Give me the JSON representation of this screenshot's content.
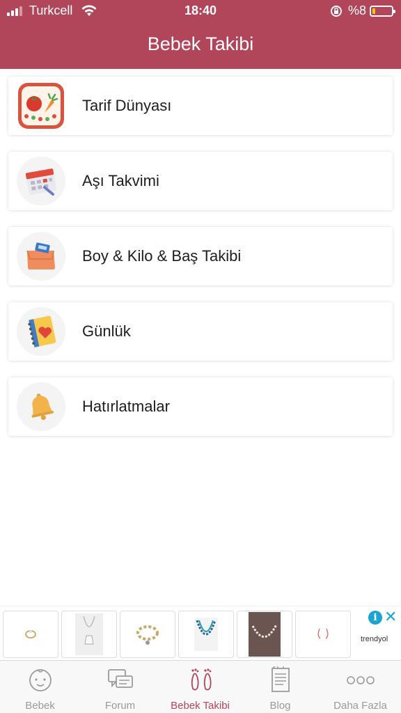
{
  "status_bar": {
    "carrier": "Turkcell",
    "time": "18:40",
    "battery_percent": "%8",
    "battery_level": 0.08
  },
  "header": {
    "title": "Bebek Takibi"
  },
  "menu": {
    "items": [
      {
        "label": "Tarif Dünyası",
        "icon": "recipe-icon"
      },
      {
        "label": "Aşı Takvimi",
        "icon": "calendar-icon"
      },
      {
        "label": "Boy & Kilo & Baş Takibi",
        "icon": "scale-icon"
      },
      {
        "label": "Günlük",
        "icon": "diary-icon"
      },
      {
        "label": "Hatırlatmalar",
        "icon": "bell-icon"
      }
    ]
  },
  "ad": {
    "brand": "trendyol",
    "info_icon": "info-icon",
    "close_icon": "close-icon"
  },
  "tabbar": {
    "tabs": [
      {
        "label": "Bebek",
        "icon": "baby-face-icon",
        "active": false
      },
      {
        "label": "Forum",
        "icon": "chat-bubbles-icon",
        "active": false
      },
      {
        "label": "Bebek Takibi",
        "icon": "footprints-icon",
        "active": true
      },
      {
        "label": "Blog",
        "icon": "document-icon",
        "active": false
      },
      {
        "label": "Daha Fazla",
        "icon": "more-dots-icon",
        "active": false
      }
    ],
    "active_color": "#b1455a",
    "inactive_color": "#9a9a9a"
  },
  "colors": {
    "header": "#b1455a",
    "ad_accent": "#1aa4d4"
  }
}
